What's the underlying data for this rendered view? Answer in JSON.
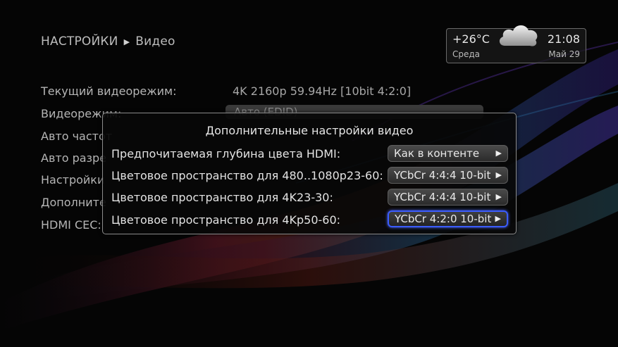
{
  "breadcrumb": {
    "section": "НАСТРОЙКИ",
    "page": "Видео"
  },
  "weather": {
    "temperature": "+26°C",
    "time": "21:08",
    "day": "Среда",
    "date": "Май 29"
  },
  "settings": {
    "rows": [
      {
        "label": "Текущий видеорежим:",
        "value": "4K 2160p 59.94Hz [10bit 4:2:0]"
      },
      {
        "label": "Видеорежим:",
        "value": "Авто (EDID)"
      },
      {
        "label": "Авто частот"
      },
      {
        "label": "Авто разре"
      },
      {
        "label": "Настройки"
      },
      {
        "label": "Дополните"
      },
      {
        "label": "HDMI CEC:"
      }
    ]
  },
  "dialog": {
    "title": "Дополнительные настройки видео",
    "items": [
      {
        "label": "Предпочитаемая глубина цвета HDMI:",
        "value": "Как в контенте"
      },
      {
        "label": "Цветовое пространство для 480..1080p23-60:",
        "value": "YCbCr 4:4:4 10-bit"
      },
      {
        "label": "Цветовое пространство для 4K23-30:",
        "value": "YCbCr 4:4:4 10-bit"
      },
      {
        "label": "Цветовое пространство для 4Kp50-60:",
        "value": "YCbCr 4:2:0 10-bit"
      }
    ]
  },
  "colors": {
    "focus_border": "#3b5cff",
    "background": "#050505"
  },
  "icons": {
    "breadcrumb_separator": "play-triangle-icon",
    "weather": "cloud-icon",
    "dropdown_arrow": "play-triangle-icon"
  }
}
